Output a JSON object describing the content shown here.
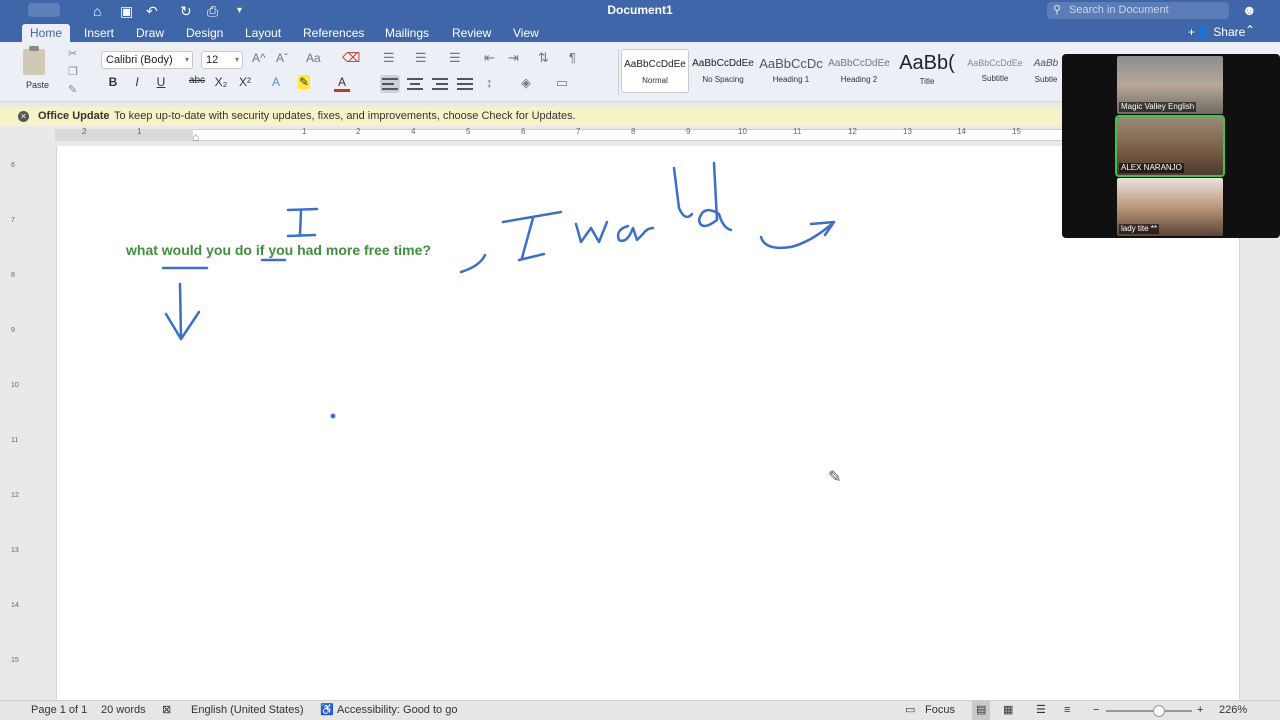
{
  "window": {
    "title": "Document1",
    "search_placeholder": "Search in Document",
    "quick_access": [
      "home-icon",
      "save-icon",
      "undo-icon",
      "redo-icon",
      "print-icon",
      "customize-icon"
    ]
  },
  "tabs": [
    {
      "label": "Home",
      "active": true
    },
    {
      "label": "Insert"
    },
    {
      "label": "Draw"
    },
    {
      "label": "Design"
    },
    {
      "label": "Layout"
    },
    {
      "label": "References"
    },
    {
      "label": "Mailings"
    },
    {
      "label": "Review"
    },
    {
      "label": "View"
    }
  ],
  "share_label": "Share",
  "ribbon": {
    "paste_label": "Paste",
    "font_name": "Calibri (Body)",
    "font_size": "12",
    "format_buttons": [
      "B",
      "I",
      "U",
      "abc",
      "X₂",
      "X²"
    ],
    "styles": [
      {
        "sample": "AaBbCcDdEe",
        "name": "Normal",
        "active": true
      },
      {
        "sample": "AaBbCcDdEe",
        "name": "No Spacing"
      },
      {
        "sample": "AaBbCcDc",
        "name": "Heading 1"
      },
      {
        "sample": "AaBbCcDdEe",
        "name": "Heading 2"
      },
      {
        "sample": "AaBb(",
        "name": "Title"
      },
      {
        "sample": "AaBbCcDdEe",
        "name": "Subtitle"
      },
      {
        "sample": "AaBb",
        "name": "Subtle"
      }
    ]
  },
  "update_bar": {
    "title": "Office Update",
    "message": "To keep up-to-date with security updates, fixes, and improvements, choose Check for Updates."
  },
  "ruler_numbers": [
    "2",
    "1",
    "1",
    "2",
    "3",
    "4",
    "5",
    "6",
    "7",
    "8",
    "9",
    "10",
    "11",
    "12",
    "13",
    "14",
    "15"
  ],
  "vruler_numbers": [
    "6",
    "7",
    "8",
    "9",
    "10",
    "11",
    "12",
    "13",
    "14",
    "15"
  ],
  "document": {
    "text": "what would you do if you had more free time?",
    "handwriting": "I would"
  },
  "status": {
    "page": "Page 1 of 1",
    "words": "20 words",
    "language": "English (United States)",
    "accessibility": "Accessibility: Good to go",
    "focus": "Focus",
    "zoom": "226%"
  },
  "participants": [
    {
      "name": "Magic Valley English"
    },
    {
      "name": "ALEX NARANJO",
      "active": true
    },
    {
      "name": "lady tite **"
    }
  ]
}
